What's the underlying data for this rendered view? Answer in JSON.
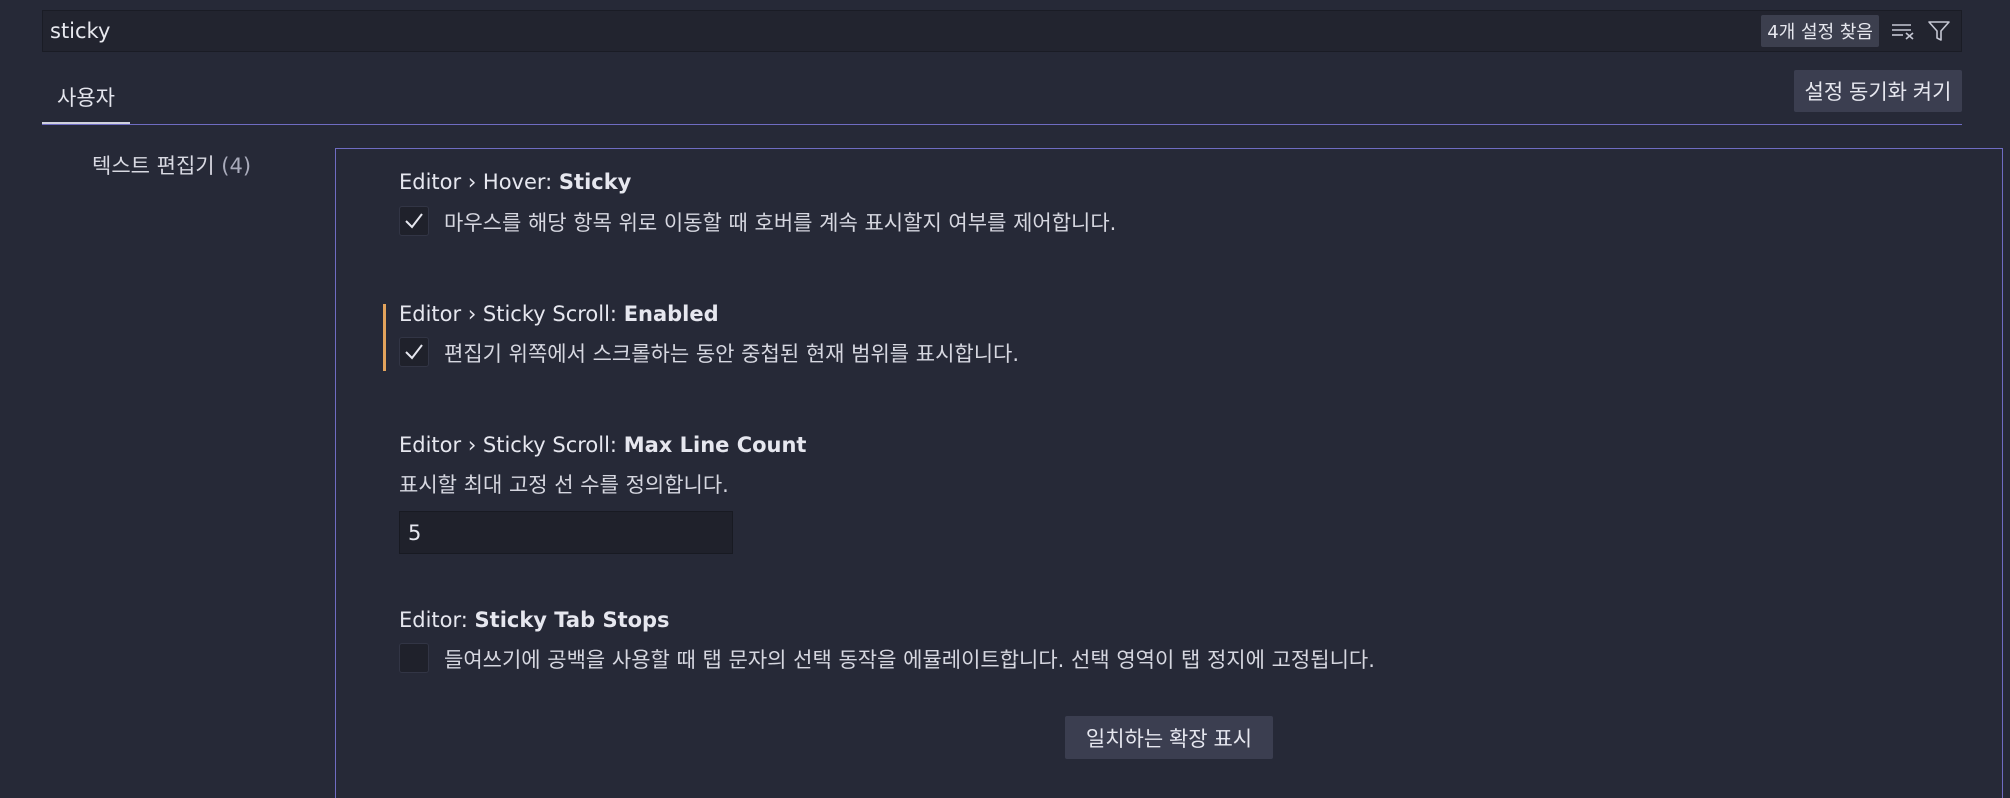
{
  "search": {
    "value": "sticky",
    "result_count": "4개 설정 찾음",
    "clear_icon": "clear-filter-icon",
    "filter_icon": "filter-icon"
  },
  "tabs": [
    {
      "label": "사용자"
    }
  ],
  "sync_button": "설정 동기화 켜기",
  "toc": {
    "label": "텍스트 편집기",
    "count": "(4)"
  },
  "settings": [
    {
      "title_prefix": "Editor › Hover: ",
      "title_key": "Sticky",
      "description": "마우스를 해당 항목 위로 이동할 때 호버를 계속 표시할지 여부를 제어합니다.",
      "type": "checkbox",
      "checked": true,
      "modified": false
    },
    {
      "title_prefix": "Editor › Sticky Scroll: ",
      "title_key": "Enabled",
      "description": "편집기 위쪽에서 스크롤하는 동안 중첩된 현재 범위를 표시합니다.",
      "type": "checkbox",
      "checked": true,
      "modified": true
    },
    {
      "title_prefix": "Editor › Sticky Scroll: ",
      "title_key": "Max Line Count",
      "description": "표시할 최대 고정 선 수를 정의합니다.",
      "type": "number",
      "value": "5",
      "modified": false
    },
    {
      "title_prefix": "Editor: ",
      "title_key": "Sticky Tab Stops",
      "description": "들여쓰기에 공백을 사용할 때 탭 문자의 선택 동작을 에뮬레이트합니다. 선택 영역이 탭 정지에 고정됩니다.",
      "type": "checkbox",
      "checked": false,
      "modified": false
    }
  ],
  "extensions_button": "일치하는 확장 표시",
  "colors": {
    "background": "#262937",
    "accent": "#6f6cc2",
    "modified_indicator": "#e2a35c"
  }
}
